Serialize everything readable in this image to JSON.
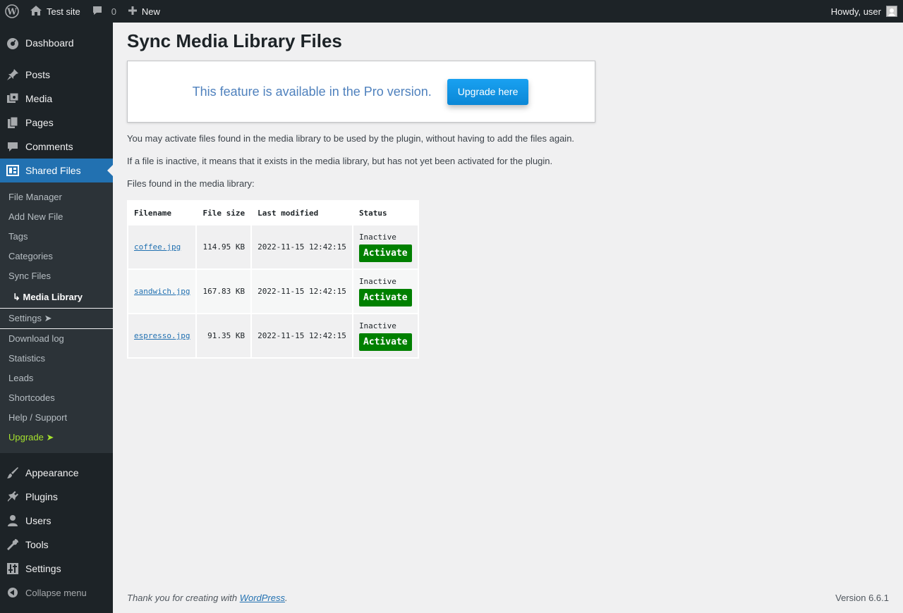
{
  "adminbar": {
    "site_name": "Test site",
    "comments_count": "0",
    "new_label": "New",
    "howdy": "Howdy, user"
  },
  "sidebar": {
    "top_items": [
      {
        "label": "Dashboard",
        "icon": "dashboard-icon"
      }
    ],
    "items": [
      {
        "label": "Posts",
        "icon": "pin-icon"
      },
      {
        "label": "Media",
        "icon": "media-icon"
      },
      {
        "label": "Pages",
        "icon": "pages-icon"
      },
      {
        "label": "Comments",
        "icon": "comment-icon"
      },
      {
        "label": "Shared Files",
        "icon": "shared-files-icon"
      }
    ],
    "submenu": [
      "File Manager",
      "Add New File",
      "Tags",
      "Categories",
      "Sync Files",
      "↳ Media Library",
      "Settings ➤",
      "Download log",
      "Statistics",
      "Leads",
      "Shortcodes",
      "Help / Support",
      "Upgrade ➤"
    ],
    "bottom_items": [
      {
        "label": "Appearance",
        "icon": "brush-icon"
      },
      {
        "label": "Plugins",
        "icon": "plugin-icon"
      },
      {
        "label": "Users",
        "icon": "users-icon"
      },
      {
        "label": "Tools",
        "icon": "wrench-icon"
      },
      {
        "label": "Settings",
        "icon": "settings-icon"
      }
    ],
    "collapse_label": "Collapse menu"
  },
  "main": {
    "title": "Sync Media Library Files",
    "pro_text": "This feature is available in the Pro version.",
    "upgrade_button": "Upgrade here",
    "info_1": "You may activate files found in the media library to be used by the plugin, without having to add the files again.",
    "info_2": "If a file is inactive, it means that it exists in the media library, but has not yet been activated for the plugin.",
    "info_3": "Files found in the media library:",
    "table": {
      "headers": [
        "Filename",
        "File size",
        "Last modified",
        "Status"
      ],
      "rows": [
        {
          "filename": "coffee.jpg",
          "size": "114.95 KB",
          "modified": "2022-11-15 12:42:15",
          "status": "Inactive",
          "action": "Activate"
        },
        {
          "filename": "sandwich.jpg",
          "size": "167.83 KB",
          "modified": "2022-11-15 12:42:15",
          "status": "Inactive",
          "action": "Activate"
        },
        {
          "filename": "espresso.jpg",
          "size": "91.35 KB",
          "modified": "2022-11-15 12:42:15",
          "status": "Inactive",
          "action": "Activate"
        }
      ]
    }
  },
  "footer": {
    "thanks_prefix": "Thank you for creating with ",
    "wordpress_link": "WordPress",
    "thanks_suffix": ".",
    "version": "Version 6.6.1"
  },
  "colors": {
    "adminbar_bg": "#1d2327",
    "accent": "#2271b1",
    "activate_green": "#008000",
    "upgrade_green": "#a6e22e",
    "pro_text": "#4f81bd"
  }
}
